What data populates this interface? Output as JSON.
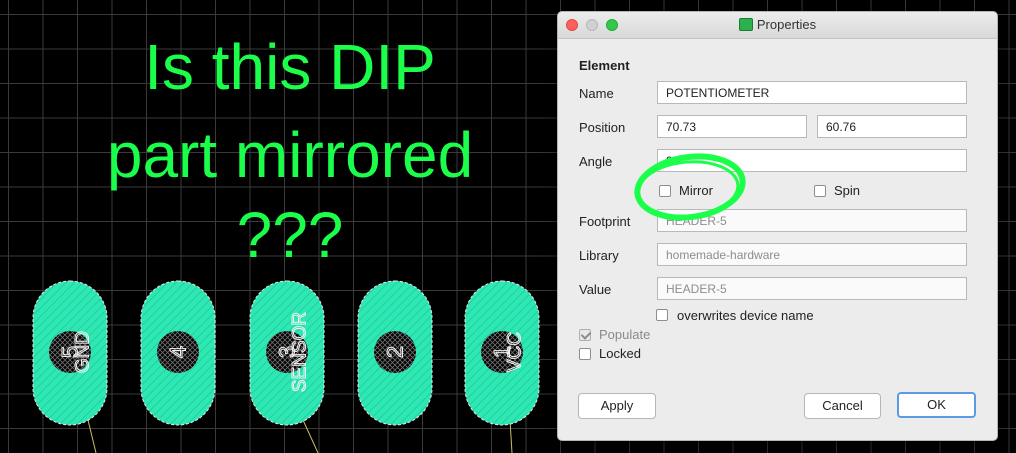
{
  "canvas": {
    "headline_lines": [
      "Is this DIP",
      "part mirrored",
      "???"
    ],
    "grid_color": "#3a3a3a",
    "text_color": "#1bff4a",
    "pad_color": "#2ee8b4",
    "pads": [
      {
        "number": "5",
        "label": "GND"
      },
      {
        "number": "4",
        "label": ""
      },
      {
        "number": "3",
        "label": "SENSOR"
      },
      {
        "number": "2",
        "label": ""
      },
      {
        "number": "1",
        "label": "VCC"
      }
    ]
  },
  "dialog": {
    "title": "Properties",
    "section_label": "Element",
    "name_label": "Name",
    "name_value": "POTENTIOMETER",
    "position_label": "Position",
    "position_x": "70.73",
    "position_y": "60.76",
    "angle_label": "Angle",
    "angle_value": "90",
    "mirror_label": "Mirror",
    "mirror_checked": false,
    "spin_label": "Spin",
    "spin_checked": false,
    "footprint_label": "Footprint",
    "footprint_value": "HEADER-5",
    "library_label": "Library",
    "library_value": "homemade-hardware",
    "value_label": "Value",
    "value_value": "HEADER-5",
    "overwrites_label": "overwrites device name",
    "overwrites_checked": false,
    "populate_label": "Populate",
    "populate_checked": true,
    "locked_label": "Locked",
    "locked_checked": false,
    "apply_label": "Apply",
    "cancel_label": "Cancel",
    "ok_label": "OK"
  }
}
